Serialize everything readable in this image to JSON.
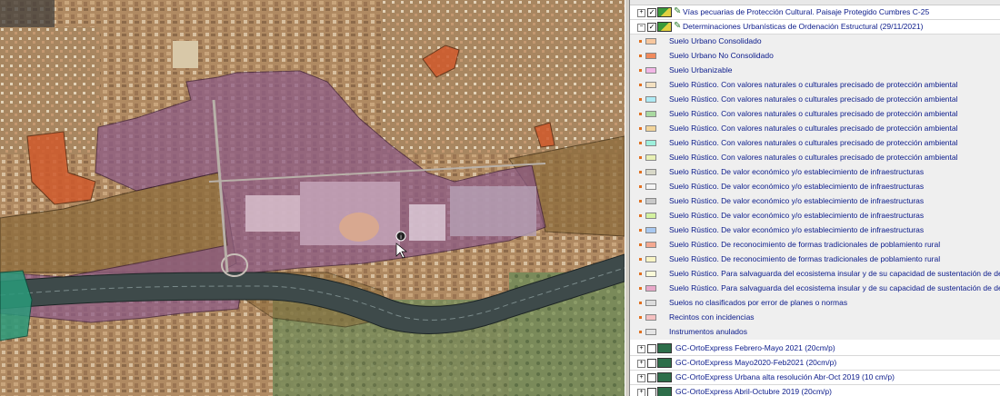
{
  "legend": {
    "top_layers": [
      {
        "label": "Vías pecuarias de Protección Cultural. Paisaje Protegido Cumbres C-25",
        "expander": "+",
        "checked": true
      },
      {
        "label": "Determinaciones Urbanísticas de Ordenación Estructural (29/11/2021)",
        "expander": "−",
        "checked": true
      }
    ],
    "items": [
      {
        "label": "Suelo Urbano Consolidado",
        "color": "#f7c79e"
      },
      {
        "label": "Suelo Urbano No Consolidado",
        "color": "#f08a5c"
      },
      {
        "label": "Suelo Urbanizable",
        "color": "#f2b6e6"
      },
      {
        "label": "Suelo Rústico. Con valores naturales o culturales precisado  de protección ambiental",
        "color": "#f3e0c0"
      },
      {
        "label": "Suelo Rústico. Con valores naturales o culturales precisado  de protección ambiental",
        "color": "#aeeaf4"
      },
      {
        "label": "Suelo Rústico. Con valores naturales o culturales precisado  de protección ambiental",
        "color": "#a9d9a0"
      },
      {
        "label": "Suelo Rústico. Con valores naturales o culturales precisado  de protección ambiental",
        "color": "#f2d49a"
      },
      {
        "label": "Suelo Rústico. Con valores naturales o culturales precisado  de protección ambiental",
        "color": "#9ef0dc"
      },
      {
        "label": "Suelo Rústico. Con valores naturales o culturales precisado  de protección ambiental",
        "color": "#e8f0b4"
      },
      {
        "label": "Suelo Rústico. De  valor económico y/o  establecimiento de infraestructuras",
        "color": "#d8d8c8"
      },
      {
        "label": "Suelo Rústico. De  valor económico y/o  establecimiento de infraestructuras",
        "color": "#f4f4f4"
      },
      {
        "label": "Suelo Rústico. De  valor económico y/o  establecimiento de infraestructuras",
        "color": "#c8c8c8"
      },
      {
        "label": "Suelo Rústico. De  valor económico y/o  establecimiento de infraestructuras",
        "color": "#d4f2a0"
      },
      {
        "label": "Suelo Rústico. De  valor económico y/o  establecimiento de infraestructuras",
        "color": "#a8c8f0"
      },
      {
        "label": "Suelo Rústico. De reconocimiento de formas tradicionales de poblamiento rural",
        "color": "#f4a890"
      },
      {
        "label": "Suelo Rústico. De reconocimiento de formas tradicionales de poblamiento rural",
        "color": "#f8f4c4"
      },
      {
        "label": "Suelo Rústico. Para salvaguarda del ecosistema insular y de  su capacidad de sustentación de desarrollo urbanístico",
        "color": "#fafad8"
      },
      {
        "label": "Suelo Rústico. Para salvaguarda del ecosistema insular y de  su capacidad de sustentación de desarrollo urbanístico",
        "color": "#e8a8c8"
      },
      {
        "label": "Suelos no clasificados por error de planes o normas",
        "color": "#dcdcdc"
      },
      {
        "label": "Recintos con incidencias",
        "color": "#f4c0c0"
      },
      {
        "label": "Instrumentos anulados",
        "color": "#e4e4e4"
      }
    ],
    "bottom_layers": [
      {
        "label": "GC-OrtoExpress Febrero-Mayo 2021 (20cm/p)",
        "expander": "+",
        "checked": false
      },
      {
        "label": "GC-OrtoExpress Mayo2020-Feb2021 (20cm/p)",
        "expander": "+",
        "checked": false
      },
      {
        "label": "GC-OrtoExpress Urbana alta resolución Abr-Oct 2019 (10 cm/p)",
        "expander": "+",
        "checked": false
      },
      {
        "label": "GC-OrtoExpress Abril-Octubre 2019 (20cm/p)",
        "expander": "+",
        "checked": false
      }
    ]
  }
}
